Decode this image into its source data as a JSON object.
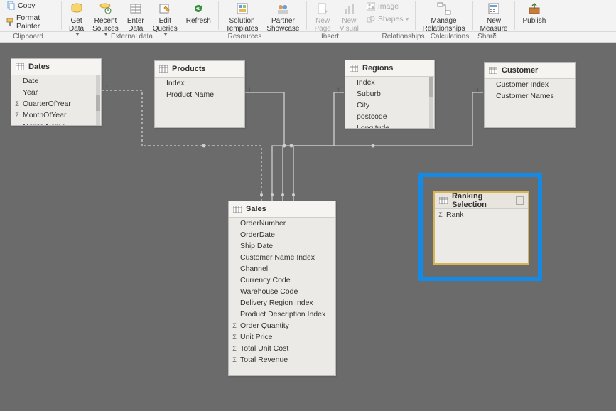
{
  "ribbon": {
    "clipboard": {
      "copy": "Copy",
      "format_painter": "Format Painter",
      "group": "Clipboard"
    },
    "external": {
      "get_data": "Get\nData",
      "recent_sources": "Recent\nSources",
      "enter_data": "Enter\nData",
      "edit_queries": "Edit\nQueries",
      "refresh": "Refresh",
      "group": "External data"
    },
    "resources": {
      "solution_templates": "Solution\nTemplates",
      "partner_showcase": "Partner\nShowcase",
      "group": "Resources"
    },
    "insert": {
      "new_page": "New\nPage",
      "new_visual": "New\nVisual",
      "image": "Image",
      "shapes": "Shapes",
      "group": "Insert"
    },
    "relationships": {
      "manage": "Manage\nRelationships",
      "group": "Relationships"
    },
    "calculations": {
      "new_measure": "New\nMeasure",
      "group": "Calculations"
    },
    "share": {
      "publish": "Publish",
      "group": "Share"
    }
  },
  "tables": {
    "dates": {
      "title": "Dates",
      "fields": [
        "Date",
        "Year",
        "QuarterOfYear",
        "MonthOfYear",
        "Month Name"
      ],
      "sigma": [
        false,
        false,
        true,
        true,
        false
      ]
    },
    "products": {
      "title": "Products",
      "fields": [
        "Index",
        "Product Name"
      ],
      "sigma": [
        false,
        false
      ]
    },
    "regions": {
      "title": "Regions",
      "fields": [
        "Index",
        "Suburb",
        "City",
        "postcode",
        "Longitude"
      ],
      "sigma": [
        false,
        false,
        false,
        false,
        false
      ]
    },
    "customer": {
      "title": "Customer",
      "fields": [
        "Customer Index",
        "Customer Names"
      ],
      "sigma": [
        false,
        false
      ]
    },
    "sales": {
      "title": "Sales",
      "fields": [
        "OrderNumber",
        "OrderDate",
        "Ship Date",
        "Customer Name Index",
        "Channel",
        "Currency Code",
        "Warehouse Code",
        "Delivery Region Index",
        "Product Description Index",
        "Order Quantity",
        "Unit Price",
        "Total Unit Cost",
        "Total Revenue"
      ],
      "sigma": [
        false,
        false,
        false,
        false,
        false,
        false,
        false,
        false,
        false,
        true,
        true,
        true,
        true
      ]
    },
    "ranking": {
      "title": "Ranking Selection",
      "fields": [
        "Rank"
      ],
      "sigma": [
        true
      ]
    }
  },
  "cardinality_one": "1"
}
